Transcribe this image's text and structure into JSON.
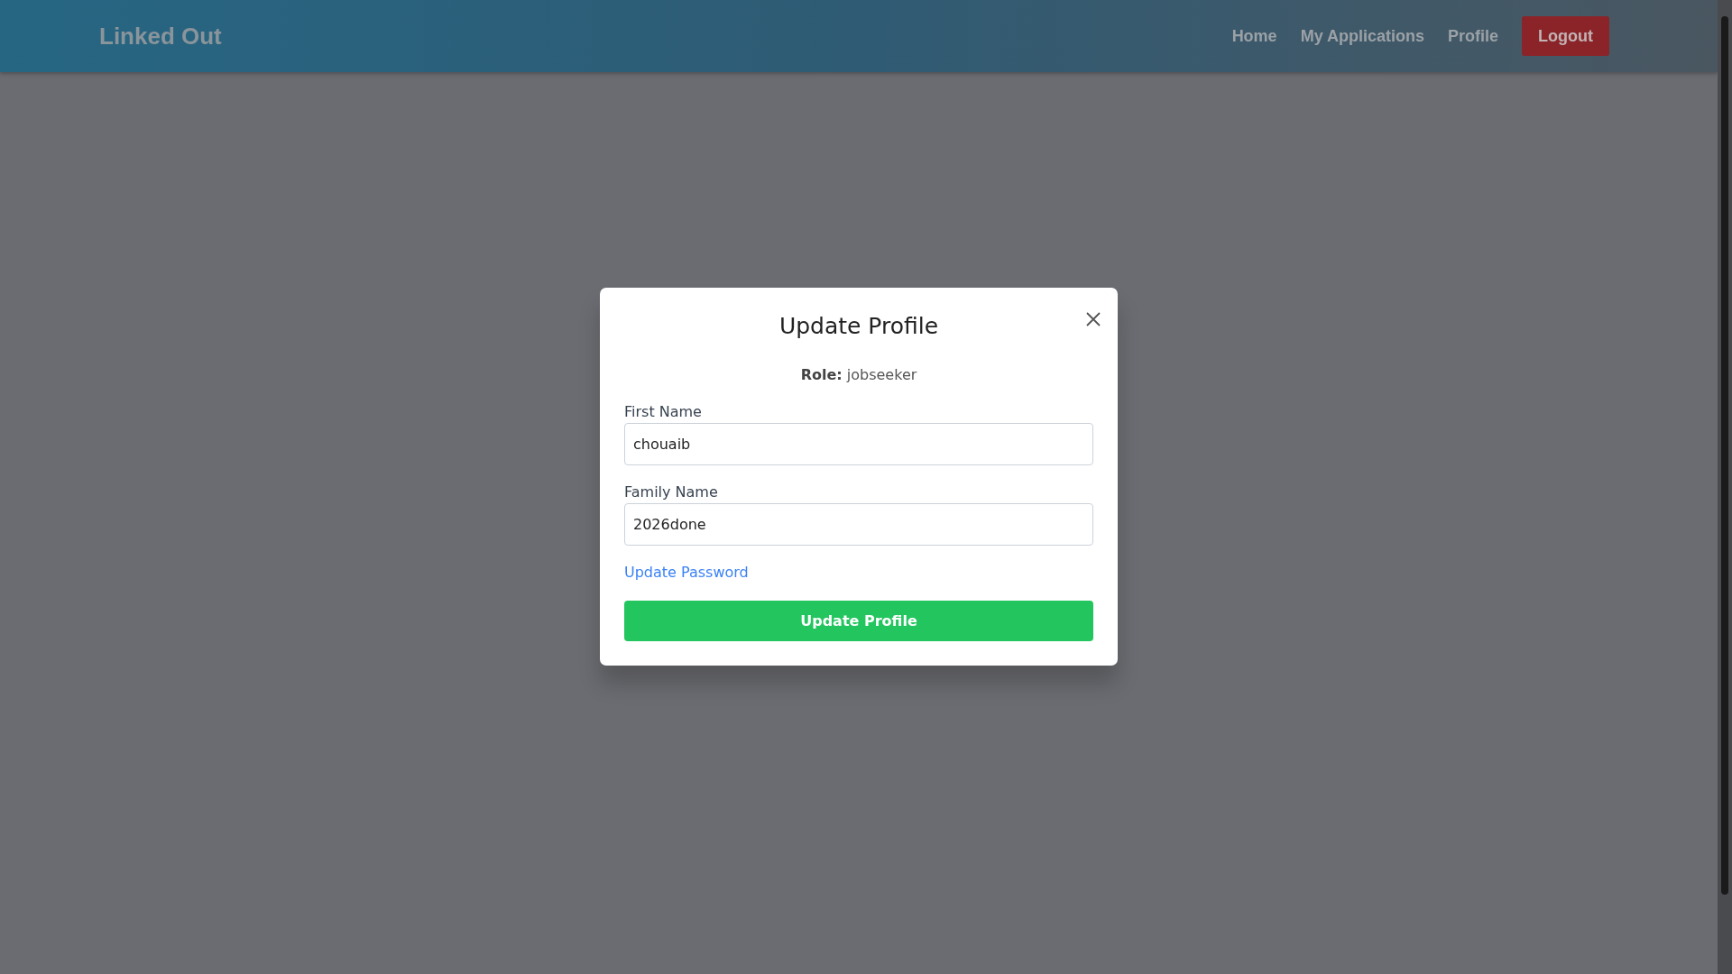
{
  "header": {
    "brand": "Linked Out",
    "nav": [
      {
        "label": "Home",
        "kind": "link"
      },
      {
        "label": "My Applications",
        "kind": "link"
      },
      {
        "label": "Profile",
        "kind": "link"
      },
      {
        "label": "Logout",
        "kind": "button"
      }
    ]
  },
  "modal": {
    "title": "Update Profile",
    "role": "**Role:** jobseeker",
    "fields": [
      {
        "label": "First Name",
        "value": "chouaib"
      },
      {
        "label": "Family Name",
        "value": "2026done"
      }
    ],
    "link": "Update Password",
    "submit": "Update Profile"
  }
}
